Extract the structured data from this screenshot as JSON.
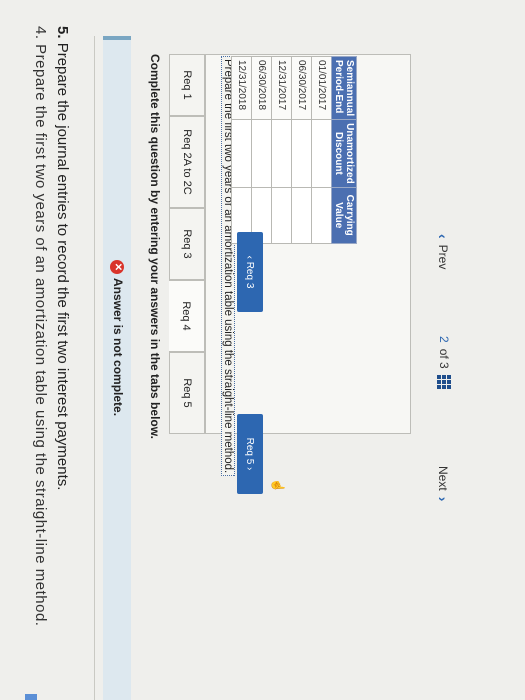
{
  "question": {
    "cut_line": "4. Prepare the first two years of an amortization table using the straight-line method.",
    "number": "5.",
    "text": "Prepare the journal entries to record the first two interest payments."
  },
  "banner": {
    "icon": "error-x-icon",
    "text": "Answer is not complete.",
    "color": "#d9342b"
  },
  "instruction": "Complete this question by entering your answers in the tabs below.",
  "tabs": [
    {
      "label": "Req 1"
    },
    {
      "label": "Req 2A to 2C"
    },
    {
      "label": "Req 3"
    },
    {
      "label": "Req 4",
      "active": true
    },
    {
      "label": "Req 5"
    }
  ],
  "prompt": "Prepare the first two years of an amortization table using the straight-line method.",
  "table": {
    "headers": [
      [
        "Semiannual",
        "Period-End"
      ],
      [
        "Unamortized",
        "Discount"
      ],
      [
        "Carrying",
        "Value"
      ]
    ],
    "rows": [
      {
        "period": "01/01/2017"
      },
      {
        "period": "06/30/2017"
      },
      {
        "period": "12/31/2017"
      },
      {
        "period": "06/30/2018"
      },
      {
        "period": "12/31/2018"
      }
    ],
    "header_color": "#4b6fb1"
  },
  "nav": {
    "prev_tab": "Req 3",
    "next_tab": "Req 5",
    "button_color": "#2d67b1"
  },
  "footer": {
    "prev": "Prev",
    "page": "2",
    "of": "of 3",
    "next": "Next"
  }
}
